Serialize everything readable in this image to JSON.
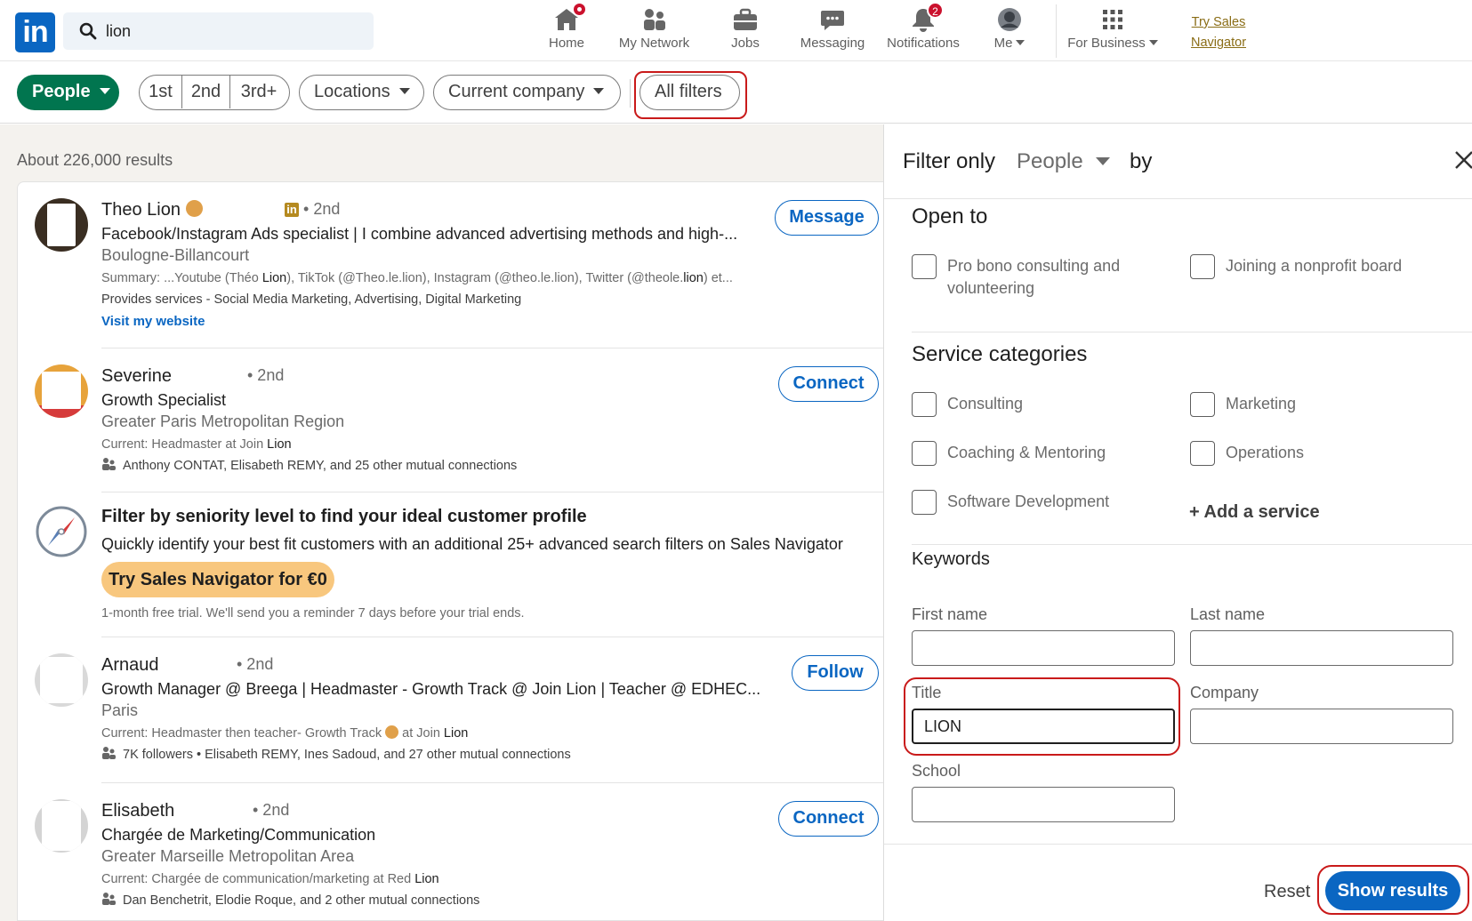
{
  "nav": {
    "logo_text": "in",
    "search_value": "lion",
    "items": [
      {
        "label": "Home",
        "badge": ""
      },
      {
        "label": "My Network",
        "badge": ""
      },
      {
        "label": "Jobs",
        "badge": ""
      },
      {
        "label": "Messaging",
        "badge": ""
      },
      {
        "label": "Notifications",
        "badge": "2"
      },
      {
        "label": "Me",
        "badge": ""
      },
      {
        "label": "For Business",
        "badge": ""
      }
    ],
    "try_sales_line1": "Try Sales",
    "try_sales_line2": "Navigator"
  },
  "filters": {
    "people": "People",
    "degree_1": "1st",
    "degree_2": "2nd",
    "degree_3": "3rd+",
    "locations": "Locations",
    "current_company": "Current company",
    "all_filters": "All filters"
  },
  "results": {
    "count": "About 226,000 results",
    "items": [
      {
        "name": "Theo Lion",
        "degree": "• 2nd",
        "headline": "Facebook/Instagram Ads specialist | I combine advanced advertising methods and high-...",
        "location": "Boulogne-Billancourt",
        "summary_prefix": "Summary: ...Youtube (Théo ",
        "summary_bold1": "Lion",
        "summary_mid": "), TikTok (@Theo.le.lion), Instagram (@theo.le.lion), Twitter (@theole.",
        "summary_bold2": "lion",
        "summary_suffix": ") et...",
        "services": "Provides services - Social Media Marketing, Advertising, Digital Marketing",
        "website": "Visit my website",
        "action": "Message"
      },
      {
        "name": "Severine",
        "degree": "• 2nd",
        "headline": "Growth Specialist",
        "location": "Greater Paris Metropolitan Region",
        "current_prefix": "Current: Headmaster at Join ",
        "current_bold": "Lion",
        "mutual": "Anthony CONTAT, Elisabeth REMY, and 25 other mutual connections",
        "action": "Connect"
      },
      {
        "name": "Arnaud",
        "degree": "• 2nd",
        "headline": "Growth Manager @ Breega | Headmaster - Growth Track @ Join Lion | Teacher @ EDHEC...",
        "location": "Paris",
        "current_prefix": "Current: Headmaster then teacher- Growth Track ",
        "current_mid": " at Join ",
        "current_bold": "Lion",
        "mutual": "7K followers • Elisabeth REMY, Ines Sadoud, and 27 other mutual connections",
        "action": "Follow"
      },
      {
        "name": "Elisabeth",
        "degree": "• 2nd",
        "headline": "Chargée de Marketing/Communication",
        "location": "Greater Marseille Metropolitan Area",
        "current_prefix": "Current: Chargée de communication/marketing at Red ",
        "current_bold": "Lion",
        "mutual": "Dan Benchetrit, Elodie Roque, and 2 other mutual connections",
        "action": "Connect"
      }
    ],
    "promo": {
      "title": "Filter by seniority level to find your ideal customer profile",
      "text": "Quickly identify your best fit customers with an additional 25+ advanced search filters on Sales Navigator",
      "button": "Try Sales Navigator for €0",
      "note": "1-month free trial. We'll send you a reminder 7 days before your trial ends."
    }
  },
  "panel": {
    "filter_only": "Filter only",
    "people": "People",
    "by": "by",
    "open_to_title": "Open to",
    "open_to": [
      {
        "line1": "Pro bono consulting and",
        "line2": "volunteering"
      },
      {
        "line1": "Joining a nonprofit board",
        "line2": ""
      }
    ],
    "service_title": "Service categories",
    "services": [
      "Consulting",
      "Marketing",
      "Coaching & Mentoring",
      "Operations",
      "Software Development"
    ],
    "add_service": "+ Add a service",
    "keywords_title": "Keywords",
    "first_name_label": "First name",
    "last_name_label": "Last name",
    "title_label": "Title",
    "title_value": "LION",
    "company_label": "Company",
    "school_label": "School",
    "first_name_value": "",
    "last_name_value": "",
    "company_value": "",
    "school_value": "",
    "reset": "Reset",
    "show_results": "Show results"
  },
  "colors": {
    "brand_blue": "#0a66c2",
    "people_green": "#01754f",
    "annotation_red": "#c91a1a",
    "promo_gold": "#f8c77e",
    "notif_red": "#cb112d"
  }
}
